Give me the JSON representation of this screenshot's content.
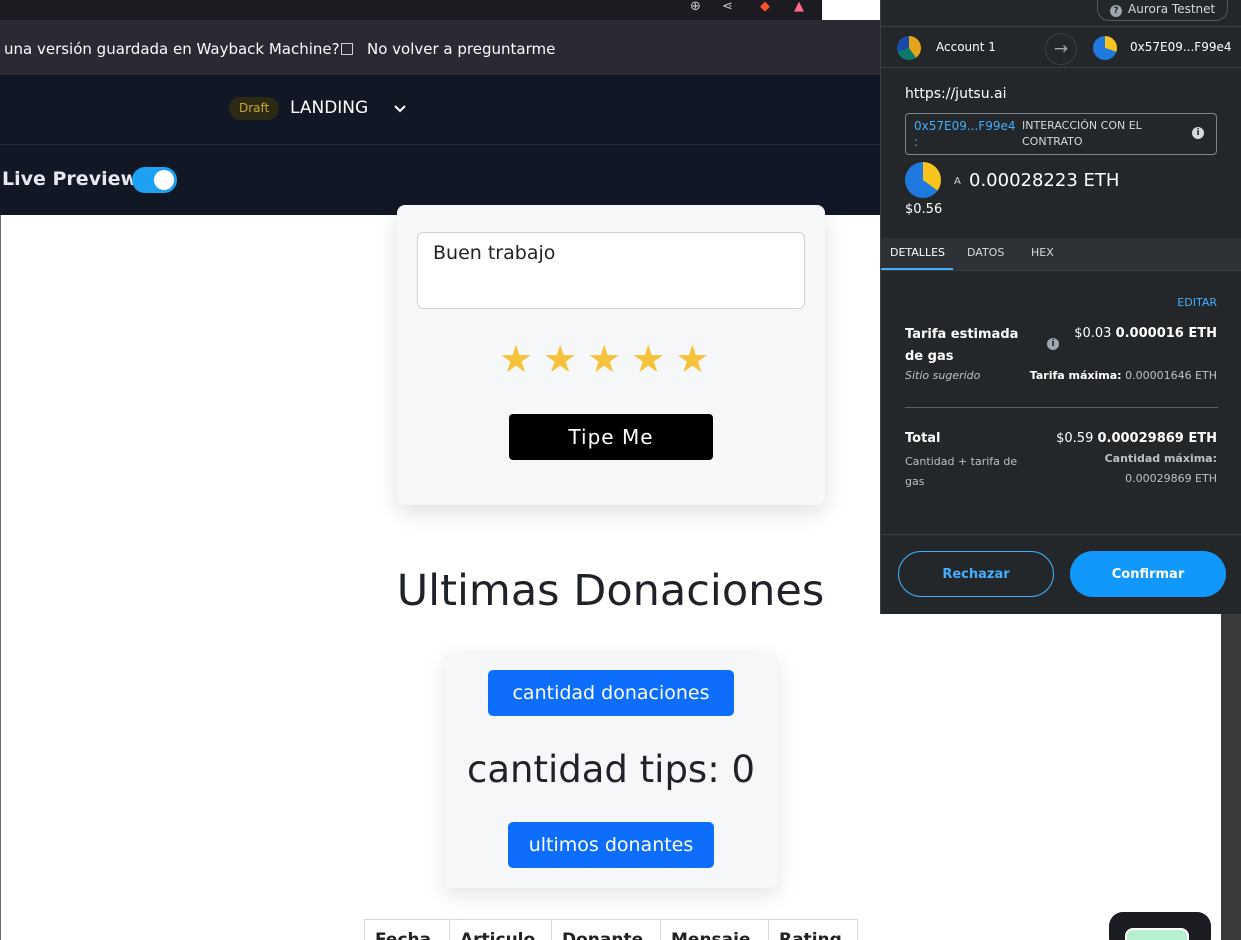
{
  "wayback_bar": {
    "question": "una versión guardada en Wayback Machine?",
    "dont_ask": "No volver a preguntarme"
  },
  "app_header": {
    "draft_badge": "Draft",
    "page_name": "LANDING",
    "live_preview_label": "Live Preview"
  },
  "tip_form": {
    "message_value": "Buen trabajo",
    "rating": 5,
    "stars": [
      "★",
      "★",
      "★",
      "★",
      "★"
    ],
    "submit_label": "Tipe Me"
  },
  "donations": {
    "title": "Ultimas Donaciones",
    "count_button": "cantidad donaciones",
    "tips_count_text": "cantidad tips: 0",
    "donors_button": "ultimos donantes",
    "table_headers": [
      "Fecha",
      "Articulo",
      "Donante",
      "Mensaje",
      "Rating"
    ]
  },
  "wallet": {
    "network": "Aurora Testnet",
    "account_name": "Account 1",
    "to_address": "0x57E09...F99e4",
    "origin": "https://jutsu.ai",
    "contract_address": "0x57E09...F99e4 :",
    "contract_label": "INTERACCIÓN CON EL CONTRATO",
    "amount_prefix": "A",
    "amount": "0.00028223 ETH",
    "amount_usd": "$0.56",
    "tabs": [
      "DETALLES",
      "DATOS",
      "HEX"
    ],
    "edit_label": "EDITAR",
    "gas_label": "Tarifa estimada de gas",
    "gas_usd": "$0.03",
    "gas_eth": "0.000016 ETH",
    "gas_sub": "Sitio sugerido",
    "gas_max_label": "Tarifa máxima:",
    "gas_max_value": "0.00001646 ETH",
    "total_label": "Total",
    "total_usd": "$0.59",
    "total_eth": "0.00029869 ETH",
    "total_sub": "Cantidad + tarifa de gas",
    "total_max_label": "Cantidad máxima:",
    "total_max_value": "0.00029869 ETH",
    "reject_label": "Rechazar",
    "confirm_label": "Confirmar"
  },
  "colors": {
    "accent_blue": "#0d6efd",
    "star_yellow": "#f7c23b",
    "metamask_blue": "#43aefc",
    "header_bg": "#121725"
  },
  "icons": [
    "zoom-icon",
    "share-icon",
    "brave-icon",
    "triangle-icon",
    "chevron-down-icon",
    "arrow-right-icon",
    "info-icon",
    "star-icon"
  ]
}
